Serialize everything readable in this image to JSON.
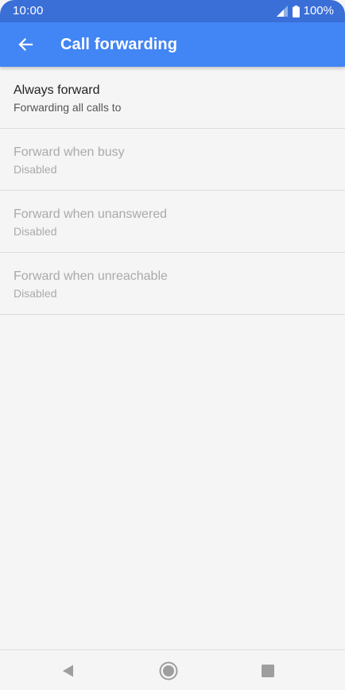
{
  "status_bar": {
    "time": "10:00",
    "battery": "100%",
    "icons": [
      "signal-icon",
      "battery-icon"
    ]
  },
  "app_bar": {
    "title": "Call forwarding",
    "back_icon": "arrow-left-icon",
    "color": "#4285f4"
  },
  "forwarding_options": [
    {
      "title": "Always forward",
      "subtitle": "Forwarding all calls to",
      "enabled": true
    },
    {
      "title": "Forward when busy",
      "subtitle": "Disabled",
      "enabled": false
    },
    {
      "title": "Forward when unanswered",
      "subtitle": "Disabled",
      "enabled": false
    },
    {
      "title": "Forward when unreachable",
      "subtitle": "Disabled",
      "enabled": false
    }
  ],
  "nav_bar": {
    "icons": [
      "nav-back-icon",
      "nav-home-icon",
      "nav-recents-icon"
    ]
  }
}
